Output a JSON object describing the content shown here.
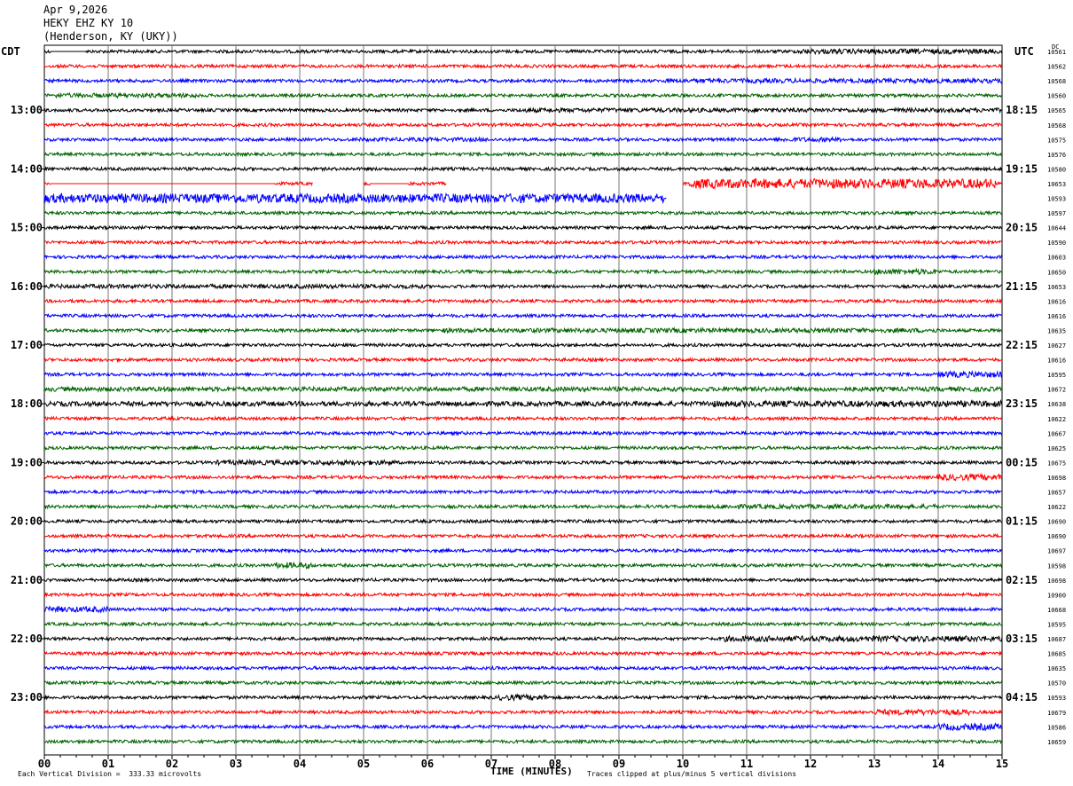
{
  "header": {
    "date": "Apr 9,2026",
    "station": "HEKY EHZ KY 10",
    "location": "(Henderson, KY (UKY))"
  },
  "left_tz": "CDT",
  "right_tz": "UTC",
  "dc_label": "DC",
  "footer": {
    "scale": "Each Vertical Division =  333.33 microvolts",
    "clip_note": "Traces clipped at plus/minus 5 vertical divisions"
  },
  "chart_data": {
    "type": "line",
    "title": "HEKY EHZ KY 10",
    "xlabel": "TIME (MINUTES)",
    "x_ticks": [
      "00",
      "01",
      "02",
      "03",
      "04",
      "05",
      "06",
      "07",
      "08",
      "09",
      "10",
      "11",
      "12",
      "13",
      "14",
      "15"
    ],
    "xlim": [
      0,
      15
    ],
    "trace_colors": [
      "#000000",
      "#ff0000",
      "#0000ff",
      "#006400"
    ],
    "left_hour_labels": [
      "13:00",
      "14:00",
      "15:00",
      "16:00",
      "17:00",
      "18:00",
      "19:00",
      "20:00",
      "21:00",
      "22:00",
      "23:00"
    ],
    "right_hour_labels": [
      "18:15",
      "19:15",
      "20:15",
      "21:15",
      "22:15",
      "23:15",
      "00:15",
      "01:15",
      "02:15",
      "03:15",
      "04:15"
    ],
    "trace_dc_offsets": [
      "10561",
      "10562",
      "10568",
      "10560",
      "10565",
      "10568",
      "10575",
      "10576",
      "10580",
      "10653",
      "10593",
      "10597",
      "10644",
      "10590",
      "10603",
      "10650",
      "10653",
      "10616",
      "10616",
      "10635",
      "10627",
      "10616",
      "10595",
      "10672",
      "10638",
      "10622",
      "10667",
      "10625",
      "10675",
      "10698",
      "10657",
      "10622",
      "10690",
      "10690",
      "10697",
      "10598",
      "10698",
      "10900",
      "10668",
      "10595",
      "10687",
      "10685",
      "10635",
      "10570",
      "10593",
      "10679",
      "10586",
      "10659"
    ],
    "features": [
      {
        "trace": 0,
        "from": 11.8,
        "to": 15,
        "amp": 1.8
      },
      {
        "trace": 2,
        "from": 9.7,
        "to": 15,
        "amp": 1.6
      },
      {
        "trace": 3,
        "from": 0.1,
        "to": 2.4,
        "amp": 1.6
      },
      {
        "trace": 4,
        "from": 7.4,
        "to": 15,
        "amp": 1.5
      },
      {
        "trace": 6,
        "from": 4.8,
        "to": 7.0,
        "amp": 1.4
      },
      {
        "trace": 6,
        "from": 11.5,
        "to": 12.5,
        "amp": 1.6
      },
      {
        "trace": 9,
        "from": 10.1,
        "to": 14.9,
        "amp": 3.4
      },
      {
        "trace": 10,
        "from": 0,
        "to": 9.7,
        "amp": 3.2
      },
      {
        "trace": 15,
        "from": 13.0,
        "to": 14.0,
        "amp": 2.0
      },
      {
        "trace": 16,
        "from": 0,
        "to": 6.0,
        "amp": 1.5
      },
      {
        "trace": 19,
        "from": 6.2,
        "to": 14.0,
        "amp": 1.6
      },
      {
        "trace": 22,
        "from": 14.0,
        "to": 15,
        "amp": 2.2
      },
      {
        "trace": 23,
        "from": 0,
        "to": 15,
        "amp": 1.6
      },
      {
        "trace": 24,
        "from": 0,
        "to": 15,
        "amp": 1.7
      },
      {
        "trace": 24,
        "from": 10.3,
        "to": 15,
        "amp": 2.2
      },
      {
        "trace": 28,
        "from": 2.7,
        "to": 5.5,
        "amp": 1.7
      },
      {
        "trace": 29,
        "from": 14.0,
        "to": 15,
        "amp": 2.2
      },
      {
        "trace": 31,
        "from": 10.5,
        "to": 14.0,
        "amp": 1.6
      },
      {
        "trace": 35,
        "from": 3.6,
        "to": 4.2,
        "amp": 2.2
      },
      {
        "trace": 38,
        "from": 0.0,
        "to": 1.0,
        "amp": 2.0
      },
      {
        "trace": 40,
        "from": 10.6,
        "to": 15,
        "amp": 2.0
      },
      {
        "trace": 44,
        "from": 7.1,
        "to": 7.9,
        "amp": 2.0
      },
      {
        "trace": 45,
        "from": 13.0,
        "to": 14.5,
        "amp": 2.0
      },
      {
        "trace": 46,
        "from": 14.0,
        "to": 15,
        "amp": 2.4
      }
    ],
    "gaps": [
      {
        "trace": 9,
        "from": 4.2,
        "to": 5.0
      },
      {
        "trace": 9,
        "from": 6.3,
        "to": 10.0
      },
      {
        "trace": 10,
        "from": 9.75,
        "to": 15
      }
    ],
    "flat_segments": [
      {
        "trace": 0,
        "from": 0.1,
        "to": 0.65
      },
      {
        "trace": 9,
        "from": 0.1,
        "to": 3.6
      },
      {
        "trace": 9,
        "from": 5.1,
        "to": 5.7
      }
    ]
  }
}
